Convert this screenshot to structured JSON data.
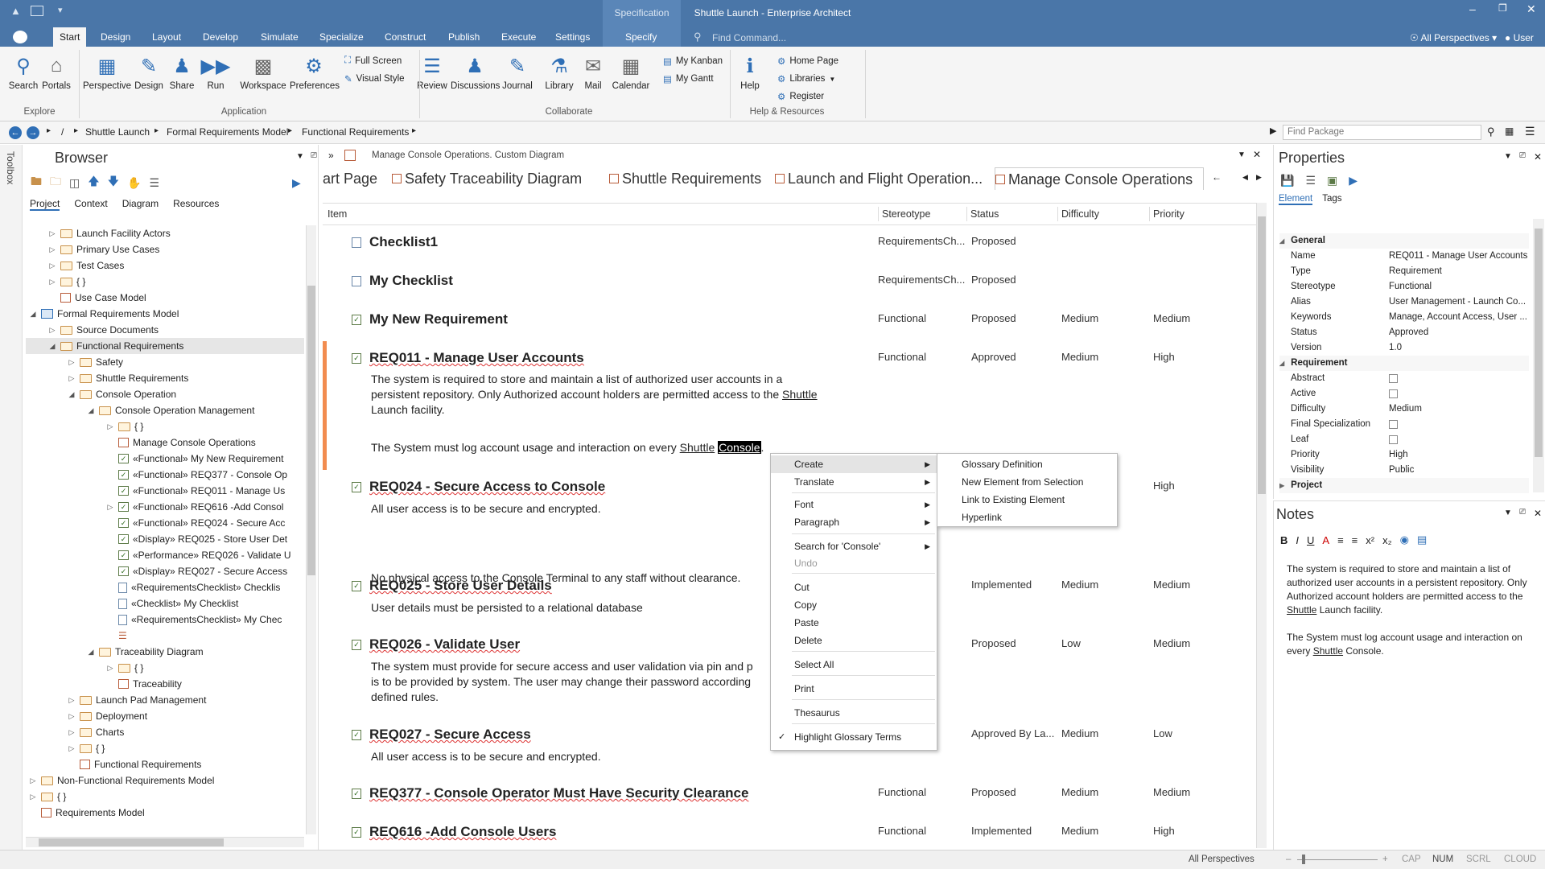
{
  "window": {
    "title": "Shuttle Launch - Enterprise Architect",
    "spec_tab": "Specification",
    "user": "User",
    "perspectives": "All Perspectives",
    "find_command": "Find Command..."
  },
  "ribbon_tabs": [
    "Start",
    "Design",
    "Layout",
    "Develop",
    "Simulate",
    "Specialize",
    "Construct",
    "Publish",
    "Execute",
    "Settings",
    "Specify"
  ],
  "ribbon": {
    "explore": {
      "label": "Explore",
      "buttons": [
        "Search",
        "Portals"
      ]
    },
    "application": {
      "label": "Application",
      "buttons": [
        "Perspective",
        "Design",
        "Share",
        "Run",
        "Workspace",
        "Preferences"
      ],
      "small": [
        "Full Screen",
        "Visual Style"
      ]
    },
    "collaborate": {
      "label": "Collaborate",
      "buttons": [
        "Review",
        "Discussions",
        "Journal",
        "Library",
        "Mail",
        "Calendar"
      ],
      "small": [
        "My Kanban",
        "My Gantt"
      ]
    },
    "help": {
      "label": "Help & Resources",
      "buttons": [
        "Help"
      ],
      "small": [
        "Home Page",
        "Libraries",
        "Register"
      ]
    }
  },
  "breadcrumb": {
    "items": [
      "/",
      "Shuttle Launch",
      "Formal Requirements Model",
      "Functional Requirements"
    ],
    "find_package": "Find Package"
  },
  "browser": {
    "title": "Browser",
    "tabs": [
      "Project",
      "Context",
      "Diagram",
      "Resources"
    ],
    "toolbox": "Toolbox",
    "tree": [
      {
        "label": "Launch Facility Actors",
        "i": 3,
        "tw": "▷",
        "ic": "fold"
      },
      {
        "label": "Primary Use Cases",
        "i": 3,
        "tw": "▷",
        "ic": "fold"
      },
      {
        "label": "Test Cases",
        "i": 3,
        "tw": "▷",
        "ic": "fold"
      },
      {
        "label": "{ }",
        "i": 3,
        "tw": "▷",
        "ic": "fold"
      },
      {
        "label": "Use Case Model",
        "i": 3,
        "tw": "",
        "ic": "diag"
      },
      {
        "label": "Formal Requirements Model",
        "i": 2,
        "tw": "◢",
        "ic": "model"
      },
      {
        "label": "Source Documents",
        "i": 3,
        "tw": "▷",
        "ic": "fold"
      },
      {
        "label": "Functional Requirements",
        "i": 3,
        "tw": "◢",
        "ic": "fold",
        "sel": true
      },
      {
        "label": "Safety",
        "i": 4,
        "tw": "▷",
        "ic": "fold"
      },
      {
        "label": "Shuttle Requirements",
        "i": 4,
        "tw": "▷",
        "ic": "fold"
      },
      {
        "label": "Console Operation",
        "i": 4,
        "tw": "◢",
        "ic": "fold"
      },
      {
        "label": "Console Operation Management",
        "i": 5,
        "tw": "◢",
        "ic": "fold"
      },
      {
        "label": "{ }",
        "i": 6,
        "tw": "▷",
        "ic": "fold"
      },
      {
        "label": "Manage Console Operations",
        "i": 6,
        "tw": "",
        "ic": "diag"
      },
      {
        "label": "«Functional» My New Requirement",
        "i": 6,
        "tw": "",
        "ic": "tick"
      },
      {
        "label": "«Functional» REQ377 - Console Op",
        "i": 6,
        "tw": "",
        "ic": "tick"
      },
      {
        "label": "«Functional» REQ011 - Manage Us",
        "i": 6,
        "tw": "",
        "ic": "tick"
      },
      {
        "label": "«Functional» REQ616 -Add Consol",
        "i": 6,
        "tw": "▷",
        "ic": "tick"
      },
      {
        "label": "«Functional» REQ024 - Secure Acc",
        "i": 6,
        "tw": "",
        "ic": "tick"
      },
      {
        "label": "«Display» REQ025 - Store User Det",
        "i": 6,
        "tw": "",
        "ic": "tick"
      },
      {
        "label": "«Performance» REQ026 - Validate U",
        "i": 6,
        "tw": "",
        "ic": "tick"
      },
      {
        "label": "«Display» REQ027 - Secure Access",
        "i": 6,
        "tw": "",
        "ic": "tick"
      },
      {
        "label": "«RequirementsChecklist» Checklis",
        "i": 6,
        "tw": "",
        "ic": "doc"
      },
      {
        "label": "«Checklist» My Checklist",
        "i": 6,
        "tw": "",
        "ic": "doc"
      },
      {
        "label": "«RequirementsChecklist» My Chec",
        "i": 6,
        "tw": "",
        "ic": "doc"
      },
      {
        "label": "",
        "i": 6,
        "tw": "",
        "ic": "list"
      },
      {
        "label": "Traceability Diagram",
        "i": 5,
        "tw": "◢",
        "ic": "fold"
      },
      {
        "label": "{ }",
        "i": 6,
        "tw": "▷",
        "ic": "fold"
      },
      {
        "label": "Traceability",
        "i": 6,
        "tw": "",
        "ic": "diag"
      },
      {
        "label": "Launch Pad Management",
        "i": 4,
        "tw": "▷",
        "ic": "fold"
      },
      {
        "label": "Deployment",
        "i": 4,
        "tw": "▷",
        "ic": "fold"
      },
      {
        "label": "Charts",
        "i": 4,
        "tw": "▷",
        "ic": "fold"
      },
      {
        "label": "{ }",
        "i": 4,
        "tw": "▷",
        "ic": "fold"
      },
      {
        "label": "Functional Requirements",
        "i": 4,
        "tw": "",
        "ic": "diag"
      },
      {
        "label": "Non-Functional Requirements Model",
        "i": 2,
        "tw": "▷",
        "ic": "fold"
      },
      {
        "label": "{ }",
        "i": 2,
        "tw": "▷",
        "ic": "fold"
      },
      {
        "label": "Requirements Model",
        "i": 2,
        "tw": "",
        "ic": "diag"
      }
    ]
  },
  "center": {
    "caption": "Manage Console Operations.  Custom Diagram",
    "doc_tabs": [
      "art Page",
      "Safety Traceability Diagram",
      "Shuttle Requirements",
      "Launch and Flight Operation...",
      "Manage Console Operations"
    ],
    "columns": [
      "Item",
      "Stereotype",
      "Status",
      "Difficulty",
      "Priority"
    ],
    "items": [
      {
        "title": "Checklist1",
        "stereotype": "RequirementsCh...",
        "status": "Proposed",
        "difficulty": "",
        "priority": "",
        "body": []
      },
      {
        "title": "My Checklist",
        "stereotype": "RequirementsCh...",
        "status": "Proposed",
        "difficulty": "",
        "priority": "",
        "body": []
      },
      {
        "title": "My New Requirement",
        "stereotype": "Functional",
        "status": "Proposed",
        "difficulty": "Medium",
        "priority": "Medium",
        "body": []
      },
      {
        "title": "REQ011 - Manage User Accounts",
        "stereotype": "Functional",
        "status": "Approved",
        "difficulty": "Medium",
        "priority": "High",
        "body": []
      },
      {
        "title": "REQ024 - Secure Access to Console",
        "stereotype": "",
        "status": "",
        "difficulty": "",
        "priority": "High",
        "body": [
          "All user access is to be secure and encrypted.",
          "",
          "No physical access to the Console Terminal to any staff without clearance."
        ]
      },
      {
        "title": "REQ025 - Store User Details",
        "stereotype": "",
        "status": "Implemented",
        "difficulty": "Medium",
        "priority": "Medium",
        "body": [
          "User details must be persisted to a relational database"
        ]
      },
      {
        "title": "REQ026 - Validate User",
        "stereotype": "",
        "status": "Proposed",
        "difficulty": "Low",
        "priority": "Medium",
        "body": [
          "The system must provide for secure access and user validation via pin and p",
          "is to be provided by system. The user may change their password according",
          "defined rules."
        ]
      },
      {
        "title": "REQ027 - Secure Access",
        "stereotype": "",
        "status": "Approved By La...",
        "difficulty": "Medium",
        "priority": "Low",
        "body": [
          "All user access is to be secure and encrypted."
        ]
      },
      {
        "title": "REQ377 - Console Operator Must Have Security Clearance",
        "stereotype": "Functional",
        "status": "Proposed",
        "difficulty": "Medium",
        "priority": "Medium",
        "body": []
      },
      {
        "title": "REQ616 -Add Console Users",
        "stereotype": "Functional",
        "status": "Implemented",
        "difficulty": "Medium",
        "priority": "High",
        "body": []
      }
    ],
    "req011_body": {
      "l1": "The system is required to store and maintain a list of authorized user accounts in a",
      "l2a": "persistent repository.  Only Authorized account holders are permitted access to the ",
      "l2b": "Shuttle",
      "l3": "Launch facility.",
      "l4a": "The System must log account usage and interaction on every ",
      "l4b": "Shuttle",
      "l4c": "Console",
      "l4d": "."
    }
  },
  "context_menu": {
    "items": [
      "Create",
      "Translate",
      "Font",
      "Paragraph",
      "Search for 'Console'",
      "Undo",
      "Cut",
      "Copy",
      "Paste",
      "Delete",
      "Select All",
      "Print",
      "Thesaurus",
      "Highlight Glossary Terms"
    ],
    "submenu": [
      "Glossary Definition",
      "New Element from Selection",
      "Link to Existing Element",
      "Hyperlink"
    ]
  },
  "properties": {
    "title": "Properties",
    "tabs": [
      "Element",
      "Tags"
    ],
    "rows": [
      {
        "k": "General",
        "v": "",
        "sec": true
      },
      {
        "k": "Name",
        "v": "REQ011 - Manage User Accounts"
      },
      {
        "k": "Type",
        "v": "Requirement"
      },
      {
        "k": "Stereotype",
        "v": "Functional"
      },
      {
        "k": "Alias",
        "v": "User Management - Launch Co..."
      },
      {
        "k": "Keywords",
        "v": "Manage, Account Access, User ..."
      },
      {
        "k": "Status",
        "v": "Approved"
      },
      {
        "k": "Version",
        "v": "1.0"
      },
      {
        "k": "Requirement",
        "v": "",
        "sec": true
      },
      {
        "k": "Abstract",
        "v": "",
        "cb": true
      },
      {
        "k": "Active",
        "v": "",
        "cb": true
      },
      {
        "k": "Difficulty",
        "v": "Medium"
      },
      {
        "k": "Final Specialization",
        "v": "",
        "cb": true
      },
      {
        "k": "Leaf",
        "v": "",
        "cb": true
      },
      {
        "k": "Priority",
        "v": "High"
      },
      {
        "k": "Visibility",
        "v": "Public"
      },
      {
        "k": "Project",
        "v": "",
        "sec": true
      }
    ]
  },
  "notes": {
    "title": "Notes",
    "p1a": "The system is required to store and maintain a list of authorized user accounts in a persistent repository.  Only Authorized account holders are permitted access to the ",
    "p1b": "Shuttle",
    "p1c": " Launch facility.",
    "p2a": "The System must log account usage and interaction on every ",
    "p2b": "Shuttle",
    "p2c": " Console."
  },
  "statusbar": {
    "perspectives": "All Perspectives",
    "cap": "CAP",
    "num": "NUM",
    "scrl": "SCRL",
    "cloud": "CLOUD"
  }
}
